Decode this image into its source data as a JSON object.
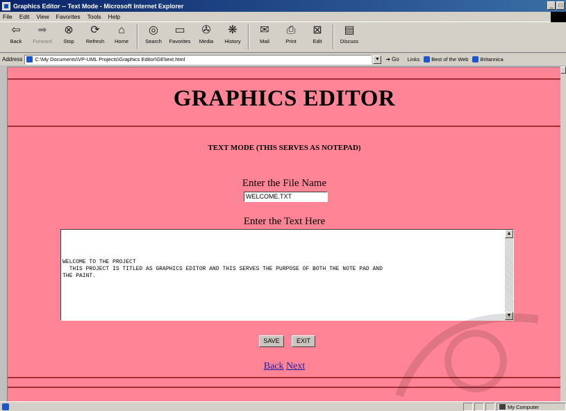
{
  "window": {
    "title": "Graphics Editor -- Text Mode - Microsoft Internet Explorer"
  },
  "menu": [
    "File",
    "Edit",
    "View",
    "Favorites",
    "Tools",
    "Help"
  ],
  "toolbar": [
    {
      "label": "Back",
      "icon": "back-arrow-icon",
      "glyph": "⇦"
    },
    {
      "label": "Forward",
      "icon": "forward-arrow-icon",
      "glyph": "➡",
      "disabled": true
    },
    {
      "label": "Stop",
      "icon": "stop-icon",
      "glyph": "⊗"
    },
    {
      "label": "Refresh",
      "icon": "refresh-icon",
      "glyph": "⟳"
    },
    {
      "label": "Home",
      "icon": "home-icon",
      "glyph": "⌂"
    },
    {
      "label": "Search",
      "icon": "search-icon",
      "glyph": "◎"
    },
    {
      "label": "Favorites",
      "icon": "favorites-icon",
      "glyph": "▭"
    },
    {
      "label": "Media",
      "icon": "media-icon",
      "glyph": "✇"
    },
    {
      "label": "History",
      "icon": "history-icon",
      "glyph": "❋"
    },
    {
      "label": "Mail",
      "icon": "mail-icon",
      "glyph": "✉"
    },
    {
      "label": "Print",
      "icon": "print-icon",
      "glyph": "⎙"
    },
    {
      "label": "Edit",
      "icon": "edit-icon",
      "glyph": "⊠"
    },
    {
      "label": "Discuss",
      "icon": "discuss-icon",
      "glyph": "▤"
    }
  ],
  "address": {
    "label": "Address",
    "url": "C:\\My Documents\\VP-UML Projects\\Graphics Editor\\GE\\text.html",
    "go": "Go",
    "links_label": "Links",
    "links": [
      "Best of the Web",
      "Britannica"
    ]
  },
  "page": {
    "title": "GRAPHICS EDITOR",
    "subtitle": "TEXT MODE (THIS SERVES AS NOTEPAD)",
    "file_label": "Enter the File Name",
    "file_value": "WELCOME.TXT",
    "text_label": "Enter the Text Here",
    "text_value": "WELCOME TO THE PROJECT\n  THIS PROJECT IS TITLED AS GRAPHICS EDITOR AND THIS SERVES THE PURPOSE OF BOTH THE NOTE PAD AND\nTHE PAINT.",
    "save_label": "SAVE",
    "exit_label": "EXIT",
    "back_link": "Back",
    "next_link": "Next"
  },
  "status": {
    "zone": "My Computer"
  }
}
